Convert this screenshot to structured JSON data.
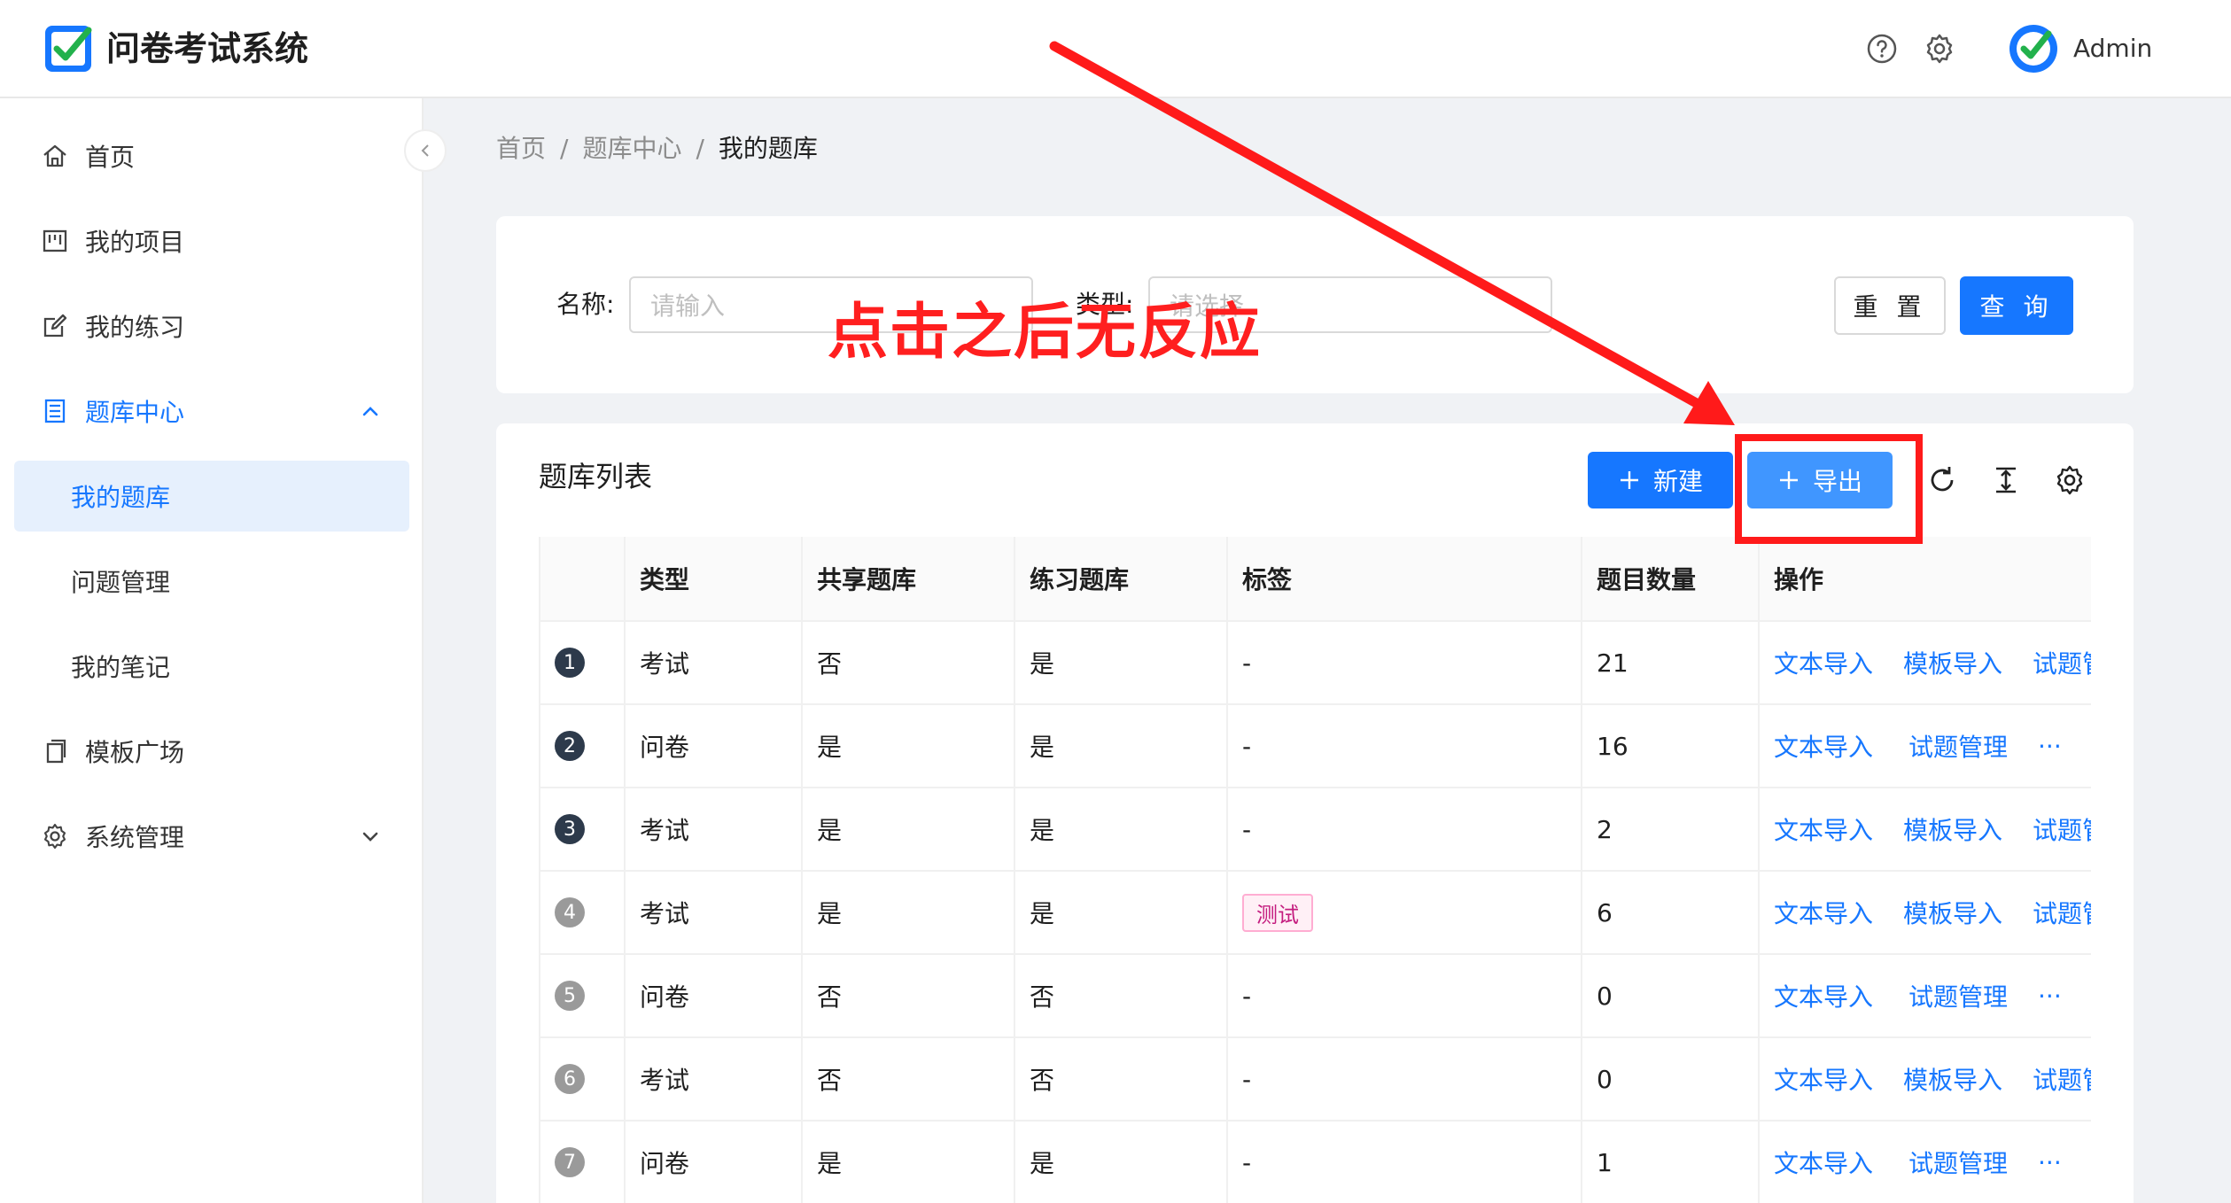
{
  "header": {
    "app_title": "问卷考试系统",
    "help_icon": "question-circle-icon",
    "settings_icon": "gear-icon",
    "user_name": "Admin"
  },
  "sidebar": {
    "items": [
      {
        "label": "首页",
        "icon": "home-icon"
      },
      {
        "label": "我的项目",
        "icon": "project-icon"
      },
      {
        "label": "我的练习",
        "icon": "edit-icon"
      },
      {
        "label": "题库中心",
        "icon": "book-icon",
        "expanded": true
      },
      {
        "label": "我的题库",
        "selected": true
      },
      {
        "label": "问题管理"
      },
      {
        "label": "我的笔记"
      },
      {
        "label": "模板广场",
        "icon": "copy-icon"
      },
      {
        "label": "系统管理",
        "icon": "gear-icon",
        "expanded": false
      }
    ]
  },
  "breadcrumb": [
    "首页",
    "题库中心",
    "我的题库"
  ],
  "search": {
    "name_label": "名称:",
    "name_placeholder": "请输入",
    "type_label": "类型:",
    "type_placeholder": "请选择",
    "reset_label": "重 置",
    "query_label": "查 询"
  },
  "table": {
    "title": "题库列表",
    "new_label": "新建",
    "export_label": "导出",
    "columns": [
      "类型",
      "共享题库",
      "练习题库",
      "标签",
      "题目数量",
      "操作"
    ],
    "rows": [
      {
        "index": "1",
        "type": "考试",
        "shared": "否",
        "practice": "是",
        "tag": "-",
        "count": "21",
        "actions": [
          "文本导入",
          "模板导入",
          "试题管"
        ]
      },
      {
        "index": "2",
        "type": "问卷",
        "shared": "是",
        "practice": "是",
        "tag": "-",
        "count": "16",
        "actions": [
          "文本导入",
          "试题管理",
          "···"
        ]
      },
      {
        "index": "3",
        "type": "考试",
        "shared": "是",
        "practice": "是",
        "tag": "-",
        "count": "2",
        "actions": [
          "文本导入",
          "模板导入",
          "试题管"
        ]
      },
      {
        "index": "4",
        "type": "考试",
        "shared": "是",
        "practice": "是",
        "tag": "测试",
        "count": "6",
        "actions": [
          "文本导入",
          "模板导入",
          "试题管"
        ]
      },
      {
        "index": "5",
        "type": "问卷",
        "shared": "否",
        "practice": "否",
        "tag": "-",
        "count": "0",
        "actions": [
          "文本导入",
          "试题管理",
          "···"
        ]
      },
      {
        "index": "6",
        "type": "考试",
        "shared": "否",
        "practice": "否",
        "tag": "-",
        "count": "0",
        "actions": [
          "文本导入",
          "模板导入",
          "试题管"
        ]
      },
      {
        "index": "7",
        "type": "问卷",
        "shared": "是",
        "practice": "是",
        "tag": "-",
        "count": "1",
        "actions": [
          "文本导入",
          "试题管理",
          "···"
        ]
      }
    ]
  },
  "annotation": {
    "text": "点击之后无反应",
    "color": "#ff1a1a"
  },
  "colors": {
    "primary": "#1677ff",
    "export_button": "#4096ff"
  }
}
